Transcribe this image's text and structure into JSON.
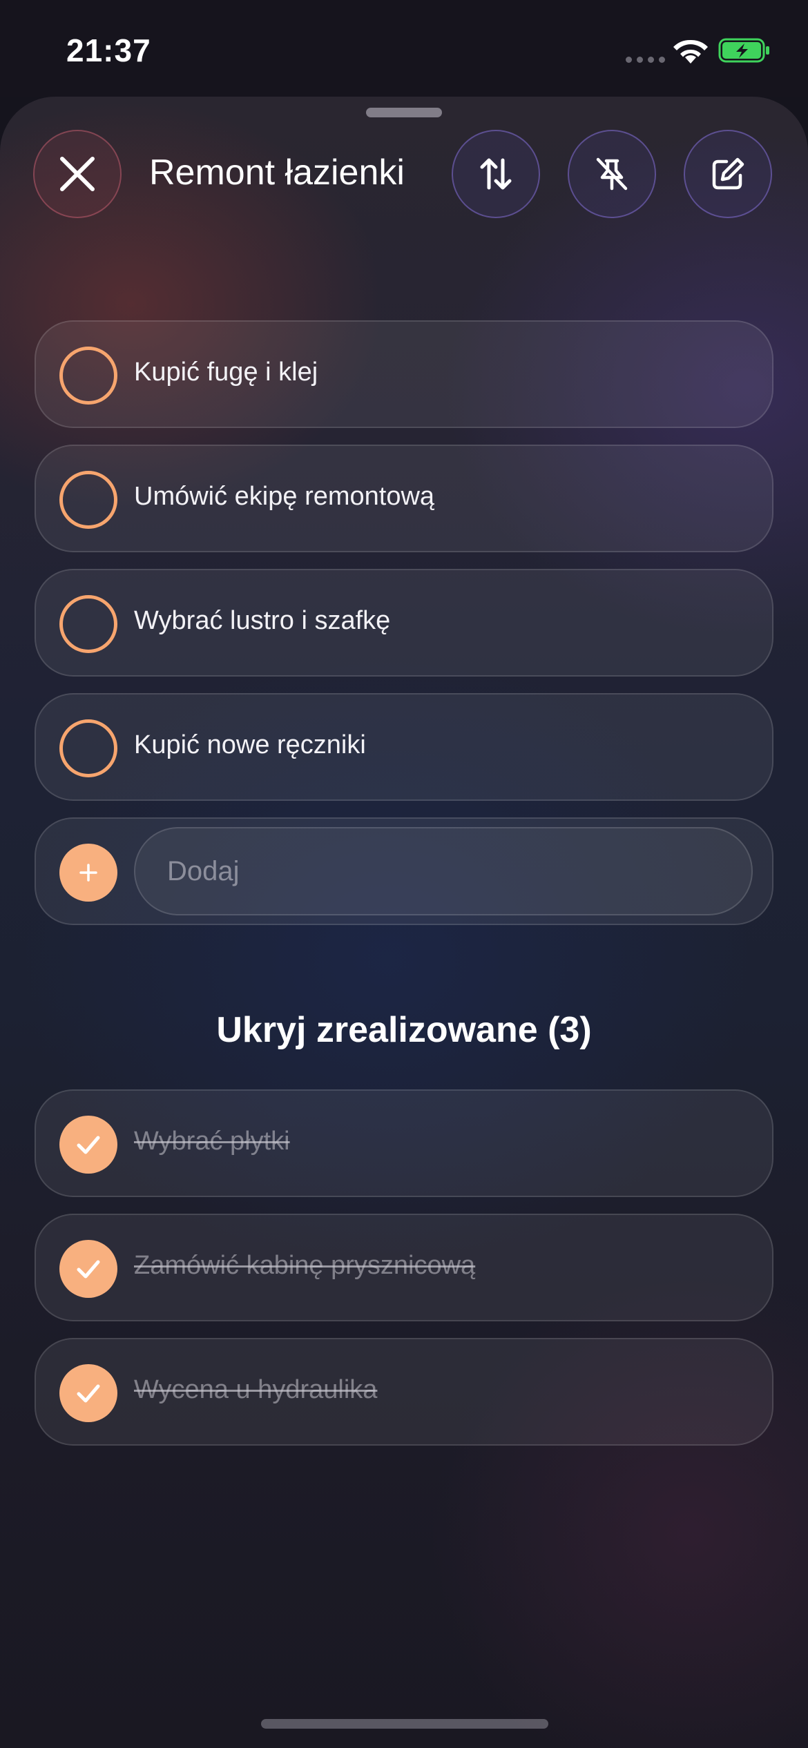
{
  "status_bar": {
    "time": "21:37"
  },
  "header": {
    "title": "Remont łazienki",
    "icons": {
      "close": "close-icon",
      "sort": "sort-arrows-icon",
      "pin": "pin-off-icon",
      "edit": "edit-icon"
    }
  },
  "tasks": {
    "open": [
      {
        "label": "Kupić fugę i klej"
      },
      {
        "label": "Umówić ekipę remontową"
      },
      {
        "label": "Wybrać lustro i szafkę"
      },
      {
        "label": "Kupić nowe ręczniki"
      }
    ],
    "add": {
      "placeholder": "Dodaj",
      "value": ""
    },
    "toggle_completed_label": "Ukryj zrealizowane (3)",
    "completed": [
      {
        "label": "Wybrać płytki"
      },
      {
        "label": "Zamówić kabinę prysznicową"
      },
      {
        "label": "Wycena u hydraulika"
      }
    ]
  },
  "colors": {
    "accent": "#f8b07f",
    "open_circle": "#f7a56e"
  }
}
